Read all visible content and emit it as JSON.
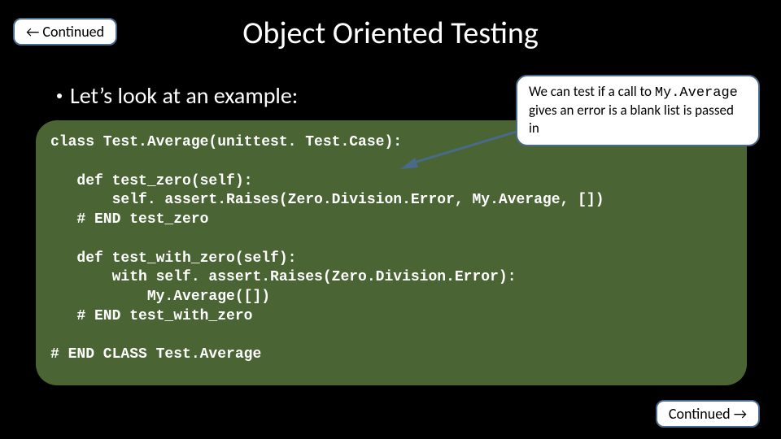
{
  "nav": {
    "prev_label": "← Continued",
    "next_label": "Continued →"
  },
  "title": "Object Oriented Testing",
  "subtitle": "Let’s look at an example:",
  "callout": {
    "prefix": "We can test if a call to ",
    "mono": "My.Average",
    "suffix": " gives an error is a blank list is passed in"
  },
  "code": "class Test.Average(unittest. Test.Case):\n\n   def test_zero(self):\n       self. assert.Raises(Zero.Division.Error, My.Average, [])\n   # END test_zero\n\n   def test_with_zero(self):\n       with self. assert.Raises(Zero.Division.Error):\n           My.Average([])\n   # END test_with_zero\n\n# END CLASS Test.Average"
}
